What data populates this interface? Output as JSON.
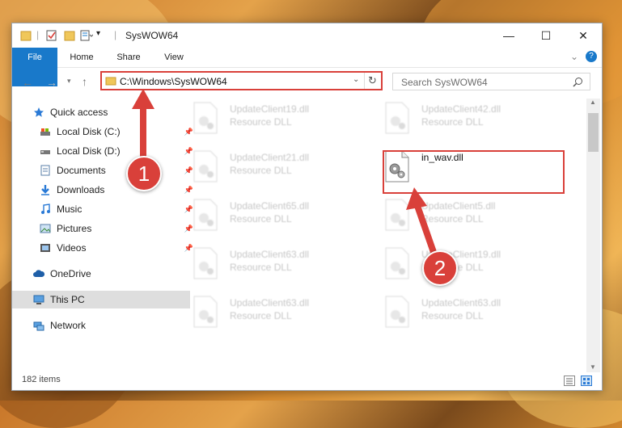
{
  "window": {
    "title": "SysWOW64",
    "minimize": "—",
    "maximize": "☐",
    "close": "✕"
  },
  "ribbon": {
    "tabs": [
      "File",
      "Home",
      "Share",
      "View"
    ],
    "help": "?",
    "expand": "⌄"
  },
  "address": {
    "path": "C:\\Windows\\SysWOW64",
    "search_placeholder": "Search SysWOW64"
  },
  "nav": {
    "items": [
      {
        "label": "Quick access",
        "icon": "star-icon"
      },
      {
        "label": "Local Disk (C:)",
        "icon": "drive-icon"
      },
      {
        "label": "Local Disk (D:)",
        "icon": "drive-icon"
      },
      {
        "label": "Documents",
        "icon": "documents-icon"
      },
      {
        "label": "Downloads",
        "icon": "download-icon"
      },
      {
        "label": "Music",
        "icon": "music-icon"
      },
      {
        "label": "Pictures",
        "icon": "pictures-icon"
      },
      {
        "label": "Videos",
        "icon": "videos-icon"
      },
      {
        "label": "OneDrive",
        "icon": "cloud-icon"
      },
      {
        "label": "This PC",
        "icon": "computer-icon"
      },
      {
        "label": "Network",
        "icon": "network-icon"
      }
    ]
  },
  "files": [
    {
      "name": "UpdateClient19.dll",
      "type": "Resource DLL"
    },
    {
      "name": "UpdateClient42.dll",
      "type": "Resource DLL"
    },
    {
      "name": "UpdateClient21.dll",
      "type": "Resource DLL"
    },
    {
      "name": "in_wav.dll",
      "type": ""
    },
    {
      "name": "UpdateClient65.dll",
      "type": "Resource DLL"
    },
    {
      "name": "UpdateClient5.dll",
      "type": "Resource DLL"
    },
    {
      "name": "UpdateClient63.dll",
      "type": "Resource DLL"
    },
    {
      "name": "UpdateClient19.dll",
      "type": "Resource DLL"
    },
    {
      "name": "UpdateClient63.dll",
      "type": "Resource DLL"
    },
    {
      "name": "UpdateClient63.dll",
      "type": "Resource DLL"
    }
  ],
  "status": {
    "count": "182 items"
  },
  "callouts": [
    "1",
    "2"
  ]
}
